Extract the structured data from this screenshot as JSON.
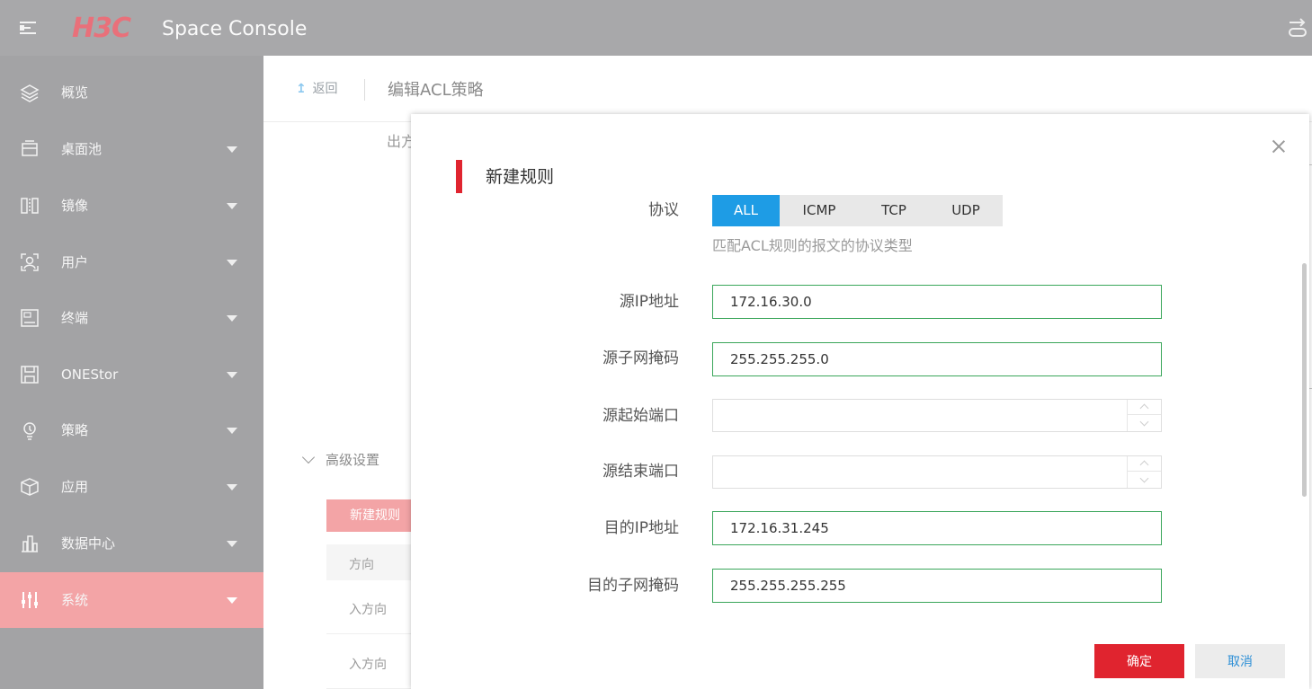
{
  "header": {
    "logo_text": "H3C",
    "product_name": "Space Console"
  },
  "sidebar": {
    "items": [
      {
        "label": "概览",
        "icon": "layers-icon",
        "has_caret": false,
        "active": false
      },
      {
        "label": "桌面池",
        "icon": "desktop-pool-icon",
        "has_caret": true,
        "active": false
      },
      {
        "label": "镜像",
        "icon": "image-icon",
        "has_caret": true,
        "active": false
      },
      {
        "label": "用户",
        "icon": "user-icon",
        "has_caret": true,
        "active": false
      },
      {
        "label": "终端",
        "icon": "terminal-icon",
        "has_caret": true,
        "active": false
      },
      {
        "label": "ONEStor",
        "icon": "storage-icon",
        "has_caret": true,
        "active": false
      },
      {
        "label": "策略",
        "icon": "policy-icon",
        "has_caret": true,
        "active": false
      },
      {
        "label": "应用",
        "icon": "app-box-icon",
        "has_caret": true,
        "active": false
      },
      {
        "label": "数据中心",
        "icon": "datacenter-icon",
        "has_caret": true,
        "active": false
      },
      {
        "label": "系统",
        "icon": "sliders-icon",
        "has_caret": true,
        "active": true
      }
    ]
  },
  "page": {
    "back_label": "返回",
    "title": "编辑ACL策略",
    "clipped_text": "出方",
    "advanced_settings_label": "高级设置",
    "new_rule_button": "新建规则",
    "table_header_direction": "方向",
    "rows": [
      {
        "direction": "入方向"
      },
      {
        "direction": "入方向"
      }
    ]
  },
  "dialog": {
    "title": "新建规则",
    "protocol": {
      "label": "协议",
      "options": [
        "ALL",
        "ICMP",
        "TCP",
        "UDP"
      ],
      "selected": "ALL",
      "help": "匹配ACL规则的报文的协议类型"
    },
    "fields": {
      "src_ip": {
        "label": "源IP地址",
        "value": "172.16.30.0"
      },
      "src_mask": {
        "label": "源子网掩码",
        "value": "255.255.255.0"
      },
      "src_port_start": {
        "label": "源起始端口",
        "value": ""
      },
      "src_port_end": {
        "label": "源结束端口",
        "value": ""
      },
      "dst_ip": {
        "label": "目的IP地址",
        "value": "172.16.31.245"
      },
      "dst_mask": {
        "label": "目的子网掩码",
        "value": "255.255.255.255"
      }
    },
    "confirm_label": "确定",
    "cancel_label": "取消"
  },
  "colors": {
    "header_bg": "#a8a8aa",
    "sidebar_bg": "#a3a3a5",
    "sidebar_active": "#f3a4a6",
    "accent_red": "#e0242f",
    "accent_blue": "#1e9ce5",
    "input_border_valid": "#3aa65a"
  }
}
